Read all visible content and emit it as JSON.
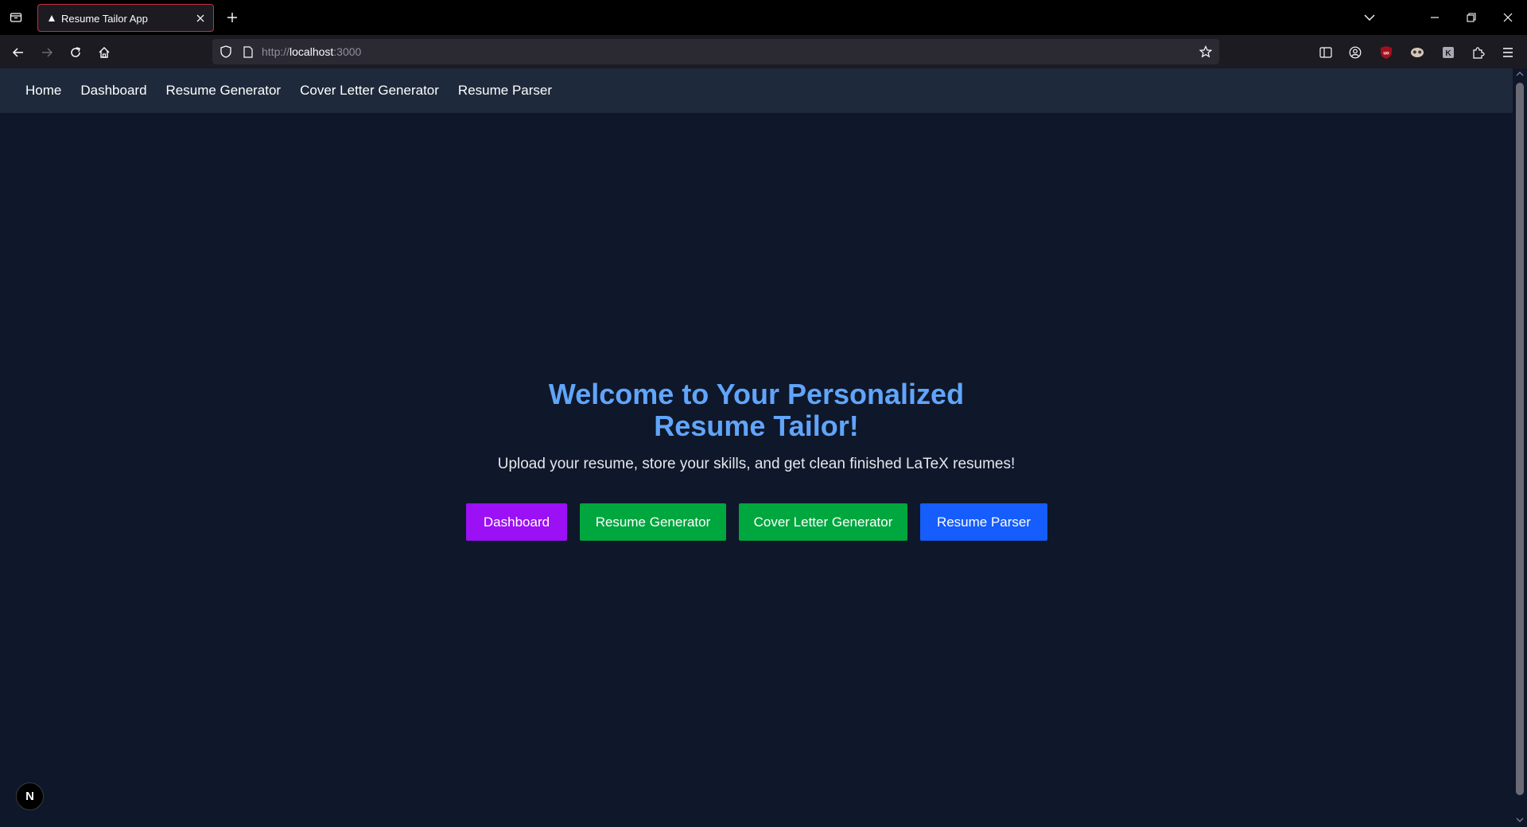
{
  "browser": {
    "tab_title": "Resume Tailor App",
    "url_prefix": "http://",
    "url_host": "localhost",
    "url_port": ":3000",
    "icons": {
      "tab_list": "tab-list-icon",
      "favicon": "triangle-favicon-icon",
      "close_tab": "close-icon",
      "new_tab": "plus-icon",
      "list_all_tabs": "chevron-down-icon",
      "minimize": "minimize-icon",
      "restore": "restore-icon",
      "close_window": "close-icon",
      "back": "back-arrow-icon",
      "forward": "forward-arrow-icon",
      "reload": "reload-icon",
      "home": "home-icon",
      "shield": "shield-icon",
      "page": "page-icon",
      "bookmark": "star-icon",
      "sidebar": "sidebar-icon",
      "account": "account-icon",
      "ublock": "ublock-icon",
      "extension_mask": "mask-extension-icon",
      "extension_k": "k-extension-icon",
      "extensions": "puzzle-icon",
      "menu": "hamburger-menu-icon"
    }
  },
  "app_nav": {
    "items": [
      {
        "label": "Home"
      },
      {
        "label": "Dashboard"
      },
      {
        "label": "Resume Generator"
      },
      {
        "label": "Cover Letter Generator"
      },
      {
        "label": "Resume Parser"
      }
    ]
  },
  "hero": {
    "title": "Welcome to Your Personalized Resume Tailor!",
    "subtitle": "Upload your resume, store your skills, and get clean finished LaTeX resumes!",
    "buttons": [
      {
        "label": "Dashboard",
        "color": "#9b10f5"
      },
      {
        "label": "Resume Generator",
        "color": "#00a63e"
      },
      {
        "label": "Cover Letter Generator",
        "color": "#00a63e"
      },
      {
        "label": "Resume Parser",
        "color": "#155dfc"
      }
    ]
  },
  "dev_badge": {
    "label": "N"
  },
  "colors": {
    "page_bg": "#0f172a",
    "nav_bg": "#1e293b",
    "title": "#60a5fa"
  }
}
